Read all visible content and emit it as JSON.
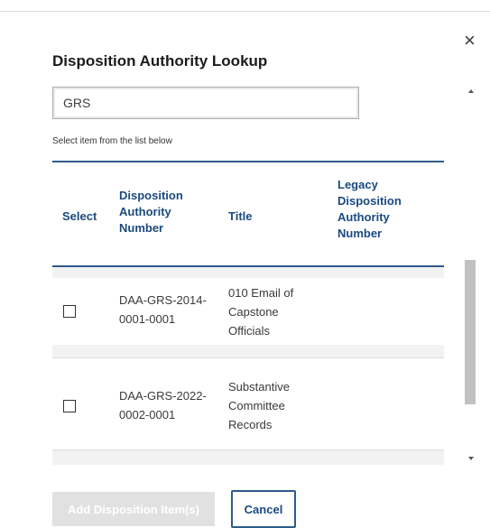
{
  "dialog": {
    "title": "Disposition Authority Lookup",
    "close_icon": "×"
  },
  "search": {
    "value": "GRS"
  },
  "hint": "Select item from the list below",
  "table": {
    "headers": {
      "select": "Select",
      "da_number_1": "Disposition",
      "da_number_2": "Authority",
      "da_number_3": "Number",
      "title": "Title",
      "legacy_1": "Legacy",
      "legacy_2": "Disposition",
      "legacy_3": "Authority",
      "legacy_4": "Number"
    },
    "rows": [
      {
        "da_line1": "DAA-GRS-2014-",
        "da_line2": "0001-0001",
        "title_line1": "010 Email of",
        "title_line2": "Capstone",
        "title_line3": "Officials",
        "legacy": "",
        "checked": false
      },
      {
        "da_line1": "DAA-GRS-2022-",
        "da_line2": "0002-0001",
        "title_line1": "Substantive",
        "title_line2": "Committee",
        "title_line3": "Records",
        "legacy": "",
        "checked": false
      }
    ]
  },
  "buttons": {
    "add": "Add Disposition Item(s)",
    "cancel": "Cancel"
  },
  "colors": {
    "header_text": "#1a4a80",
    "rule": "#2f5a8a",
    "disabled_button": "#e1e1e1"
  }
}
